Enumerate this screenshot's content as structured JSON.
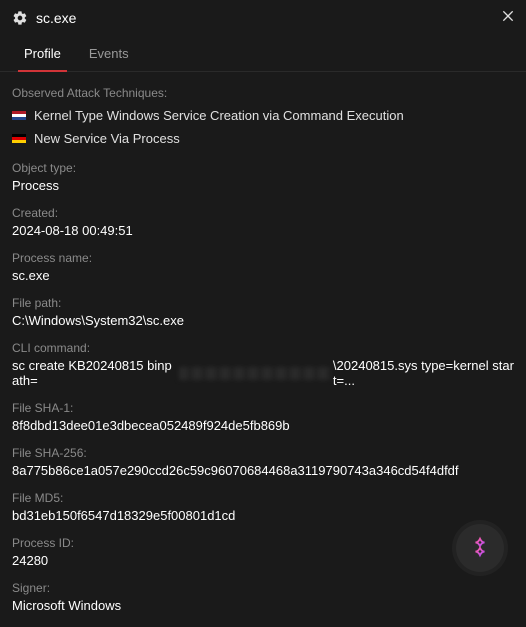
{
  "header": {
    "title": "sc.exe"
  },
  "tabs": {
    "profile": "Profile",
    "events": "Events"
  },
  "observed_attack_techniques": {
    "label": "Observed Attack Techniques:",
    "items": [
      {
        "flag": "nl",
        "name": "Kernel Type Windows Service Creation via Command Execution"
      },
      {
        "flag": "de",
        "name": "New Service Via Process"
      }
    ]
  },
  "fields": {
    "object_type": {
      "label": "Object type:",
      "value": "Process"
    },
    "created": {
      "label": "Created:",
      "value": "2024-08-18 00:49:51"
    },
    "process_name": {
      "label": "Process name:",
      "value": "sc.exe"
    },
    "file_path": {
      "label": "File path:",
      "value": "C:\\Windows\\System32\\sc.exe"
    },
    "cli_command": {
      "label": "CLI command:",
      "prefix": "sc create KB20240815 binpath=",
      "suffix": "\\20240815.sys type=kernel start=..."
    },
    "file_sha1": {
      "label": "File SHA-1:",
      "value": "8f8dbd13dee01e3dbecea052489f924de5fb869b"
    },
    "file_sha256": {
      "label": "File SHA-256:",
      "value": "8a775b86ce1a057e290ccd26c59c96070684468a3119790743a346cd54f4dfdf"
    },
    "file_md5": {
      "label": "File MD5:",
      "value": "bd31eb150f6547d18329e5f00801d1cd"
    },
    "process_id": {
      "label": "Process ID:",
      "value": "24280"
    },
    "signer": {
      "label": "Signer:",
      "value": "Microsoft Windows"
    }
  }
}
